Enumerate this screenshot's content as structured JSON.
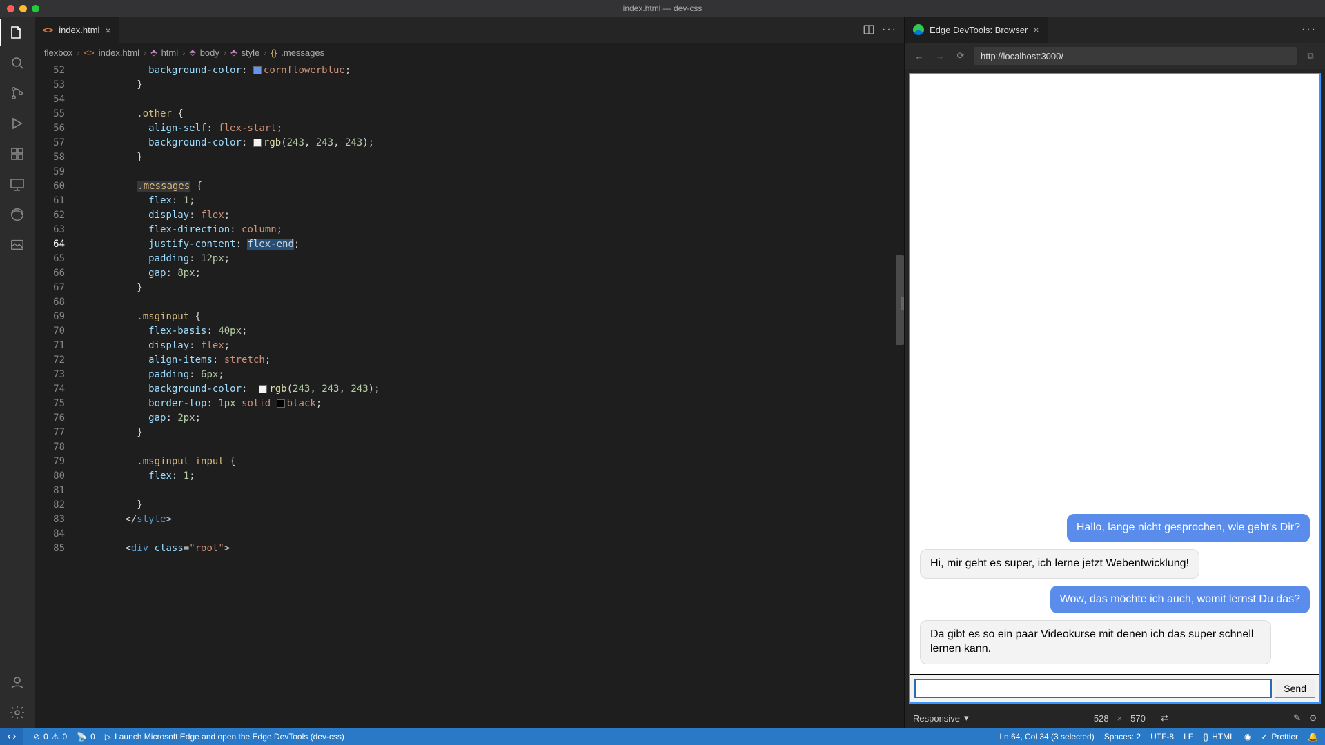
{
  "window": {
    "title": "index.html — dev-css"
  },
  "tabs": {
    "editor": {
      "label": "index.html",
      "iconLabel": "<>"
    }
  },
  "breadcrumb": [
    "flexbox",
    "index.html",
    "html",
    "body",
    "style",
    ".messages"
  ],
  "code": {
    "startLine": 52,
    "currentLine": 64,
    "lines": [
      {
        "n": 52,
        "html": "            <span class='tok-prop'>background-color</span><span class='tok-punc'>:</span> <span class='color-swatch' style='background:cornflowerblue'></span><span class='tok-val'>cornflowerblue</span><span class='tok-punc'>;</span>"
      },
      {
        "n": 53,
        "html": "          <span class='tok-punc'>}</span>"
      },
      {
        "n": 54,
        "html": ""
      },
      {
        "n": 55,
        "html": "          <span class='tok-sel'>.other</span> <span class='tok-punc'>{</span>"
      },
      {
        "n": 56,
        "html": "            <span class='tok-prop'>align-self</span><span class='tok-punc'>:</span> <span class='tok-val'>flex-start</span><span class='tok-punc'>;</span>"
      },
      {
        "n": 57,
        "html": "            <span class='tok-prop'>background-color</span><span class='tok-punc'>:</span> <span class='color-swatch' style='background:rgb(243,243,243)'></span><span class='tok-func'>rgb</span><span class='tok-punc'>(</span><span class='tok-num'>243</span><span class='tok-punc'>, </span><span class='tok-num'>243</span><span class='tok-punc'>, </span><span class='tok-num'>243</span><span class='tok-punc'>);</span>"
      },
      {
        "n": 58,
        "html": "          <span class='tok-punc'>}</span>"
      },
      {
        "n": 59,
        "html": ""
      },
      {
        "n": 60,
        "html": "          <span class='tok-sel tok-sel-highlight'>.messages</span> <span class='tok-punc'>{</span>"
      },
      {
        "n": 61,
        "html": "            <span class='tok-prop'>flex</span><span class='tok-punc'>:</span> <span class='tok-num'>1</span><span class='tok-punc'>;</span>"
      },
      {
        "n": 62,
        "html": "            <span class='tok-prop'>display</span><span class='tok-punc'>:</span> <span class='tok-val'>flex</span><span class='tok-punc'>;</span>"
      },
      {
        "n": 63,
        "html": "            <span class='tok-prop'>flex-direction</span><span class='tok-punc'>:</span> <span class='tok-val'>column</span><span class='tok-punc'>;</span>"
      },
      {
        "n": 64,
        "html": "            <span class='tok-prop'>justify-content</span><span class='tok-punc'>:</span> <span class='sel'>flex-end</span><span class='tok-punc'>;</span>"
      },
      {
        "n": 65,
        "html": "            <span class='tok-prop'>padding</span><span class='tok-punc'>:</span> <span class='tok-num'>12px</span><span class='tok-punc'>;</span>"
      },
      {
        "n": 66,
        "html": "            <span class='tok-prop'>gap</span><span class='tok-punc'>:</span> <span class='tok-num'>8px</span><span class='tok-punc'>;</span>"
      },
      {
        "n": 67,
        "html": "          <span class='tok-punc'>}</span>"
      },
      {
        "n": 68,
        "html": ""
      },
      {
        "n": 69,
        "html": "          <span class='tok-sel'>.msginput</span> <span class='tok-punc'>{</span>"
      },
      {
        "n": 70,
        "html": "            <span class='tok-prop'>flex-basis</span><span class='tok-punc'>:</span> <span class='tok-num'>40px</span><span class='tok-punc'>;</span>"
      },
      {
        "n": 71,
        "html": "            <span class='tok-prop'>display</span><span class='tok-punc'>:</span> <span class='tok-val'>flex</span><span class='tok-punc'>;</span>"
      },
      {
        "n": 72,
        "html": "            <span class='tok-prop'>align-items</span><span class='tok-punc'>:</span> <span class='tok-val'>stretch</span><span class='tok-punc'>;</span>"
      },
      {
        "n": 73,
        "html": "            <span class='tok-prop'>padding</span><span class='tok-punc'>:</span> <span class='tok-num'>6px</span><span class='tok-punc'>;</span>"
      },
      {
        "n": 74,
        "html": "            <span class='tok-prop'>background-color</span><span class='tok-punc'>:</span>  <span class='color-swatch' style='background:rgb(243,243,243)'></span><span class='tok-func'>rgb</span><span class='tok-punc'>(</span><span class='tok-num'>243</span><span class='tok-punc'>, </span><span class='tok-num'>243</span><span class='tok-punc'>, </span><span class='tok-num'>243</span><span class='tok-punc'>);</span>"
      },
      {
        "n": 75,
        "html": "            <span class='tok-prop'>border-top</span><span class='tok-punc'>:</span> <span class='tok-num'>1px</span> <span class='tok-val'>solid</span> <span class='color-swatch' style='background:#000'></span><span class='tok-val'>black</span><span class='tok-punc'>;</span>"
      },
      {
        "n": 76,
        "html": "            <span class='tok-prop'>gap</span><span class='tok-punc'>:</span> <span class='tok-num'>2px</span><span class='tok-punc'>;</span>"
      },
      {
        "n": 77,
        "html": "          <span class='tok-punc'>}</span>"
      },
      {
        "n": 78,
        "html": ""
      },
      {
        "n": 79,
        "html": "          <span class='tok-sel'>.msginput input</span> <span class='tok-punc'>{</span>"
      },
      {
        "n": 80,
        "html": "            <span class='tok-prop'>flex</span><span class='tok-punc'>:</span> <span class='tok-num'>1</span><span class='tok-punc'>;</span>"
      },
      {
        "n": 81,
        "html": ""
      },
      {
        "n": 82,
        "html": "          <span class='tok-punc'>}</span>"
      },
      {
        "n": 83,
        "html": "        <span class='tok-punc'>&lt;/</span><span class='tok-tag'>style</span><span class='tok-punc'>&gt;</span>"
      },
      {
        "n": 84,
        "html": ""
      },
      {
        "n": 85,
        "html": "        <span class='tok-punc'>&lt;</span><span class='tok-tag'>div</span> <span class='tok-attr'>class</span><span class='tok-punc'>=</span><span class='tok-str'>\"root\"</span><span class='tok-punc'>&gt;</span>"
      }
    ]
  },
  "devtools": {
    "tabLabel": "Edge DevTools: Browser",
    "url": "http://localhost:3000/",
    "viewport": {
      "mode": "Responsive",
      "width": "528",
      "height": "570"
    },
    "messages": [
      {
        "who": "me",
        "text": "Hallo, lange nicht gesprochen, wie geht's Dir?"
      },
      {
        "who": "other",
        "text": "Hi, mir geht es super, ich lerne jetzt Webentwicklung!"
      },
      {
        "who": "me",
        "text": "Wow, das möchte ich auch, womit lernst Du das?"
      },
      {
        "who": "other",
        "text": "Da gibt es so ein paar Videokurse mit denen ich das super schnell lernen kann."
      }
    ],
    "sendLabel": "Send"
  },
  "statusbar": {
    "errors": "0",
    "warnings": "0",
    "ports": "0",
    "launchText": "Launch Microsoft Edge and open the Edge DevTools (dev-css)",
    "cursor": "Ln 64, Col 34 (3 selected)",
    "spaces": "Spaces: 2",
    "encoding": "UTF-8",
    "eol": "LF",
    "lang": "HTML",
    "prettier": "Prettier"
  }
}
